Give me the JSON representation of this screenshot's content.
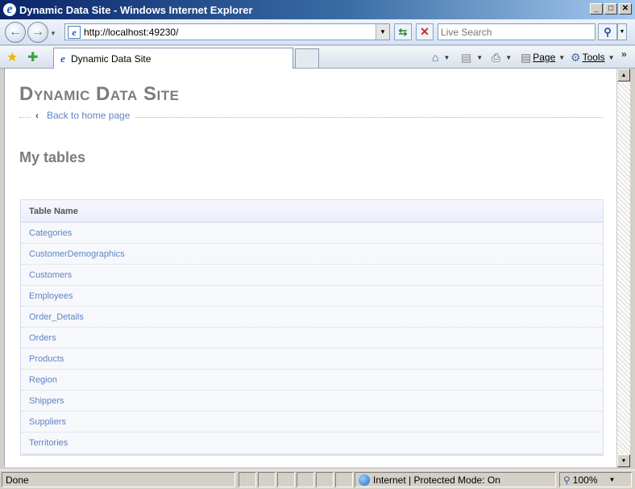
{
  "window": {
    "title": "Dynamic Data Site - Windows Internet Explorer",
    "minimize": "_",
    "maximize": "□",
    "close": "✕"
  },
  "nav": {
    "back_icon": "arrow-left-icon",
    "forward_icon": "arrow-right-icon",
    "address": "http://localhost:49230/",
    "search_placeholder": "Live Search"
  },
  "tab": {
    "title": "Dynamic Data Site"
  },
  "commands": {
    "page_label": "Page",
    "tools_label": "Tools"
  },
  "page": {
    "site_title": "Dynamic Data Site",
    "back_link": "Back to home page",
    "heading": "My tables",
    "grid_header": "Table Name",
    "tables": [
      "Categories",
      "CustomerDemographics",
      "Customers",
      "Employees",
      "Order_Details",
      "Orders",
      "Products",
      "Region",
      "Shippers",
      "Suppliers",
      "Territories"
    ]
  },
  "status": {
    "text": "Done",
    "zone": "Internet | Protected Mode: On",
    "zoom": "100%"
  },
  "colors": {
    "link": "#5e84c5",
    "heading": "#7c7c7c",
    "titlebar": "#0a246a"
  }
}
